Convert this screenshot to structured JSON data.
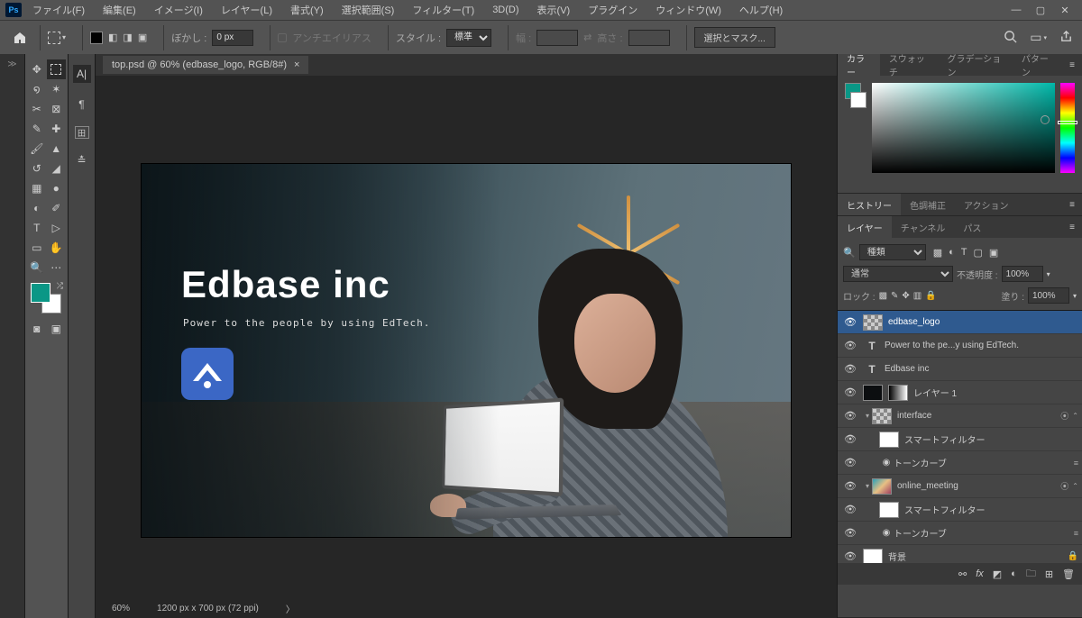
{
  "menubar": {
    "logo": "Ps",
    "items": [
      "ファイル(F)",
      "編集(E)",
      "イメージ(I)",
      "レイヤー(L)",
      "書式(Y)",
      "選択範囲(S)",
      "フィルター(T)",
      "3D(D)",
      "表示(V)",
      "プラグイン",
      "ウィンドウ(W)",
      "ヘルプ(H)"
    ]
  },
  "optionsbar": {
    "feather_label": "ぼかし :",
    "feather_value": "0 px",
    "antialias": "アンチエイリアス",
    "style_label": "スタイル :",
    "style_value": "標準",
    "width_label": "幅 :",
    "height_label": "高さ :",
    "mask_button": "選択とマスク..."
  },
  "document": {
    "tab_title": "top.psd @ 60% (edbase_logo, RGB/8#)",
    "canvas": {
      "heading": "Edbase inc",
      "subheading": "Power to the people by using EdTech."
    }
  },
  "status": {
    "zoom": "60%",
    "dims": "1200 px x 700 px (72 ppi)"
  },
  "panels": {
    "color_tabs": [
      "カラー",
      "スウォッチ",
      "グラデーション",
      "パターン"
    ],
    "history_tabs": [
      "ヒストリー",
      "色調補正",
      "アクション"
    ],
    "layer_tabs": [
      "レイヤー",
      "チャンネル",
      "パス"
    ],
    "layer_filter_label": "種類",
    "blend_mode": "通常",
    "opacity_label": "不透明度 :",
    "opacity_value": "100%",
    "lock_label": "ロック :",
    "fill_label": "塗り :",
    "fill_value": "100%",
    "layers": [
      {
        "name": "edbase_logo",
        "type": "image",
        "selected": true,
        "thumb": "checker"
      },
      {
        "name": "Power to the pe...y using EdTech.",
        "type": "T"
      },
      {
        "name": "Edbase inc",
        "type": "T"
      },
      {
        "name": "レイヤー 1",
        "type": "image",
        "thumb": "grad",
        "extra_thumb": "dark"
      },
      {
        "name": "interface",
        "type": "group",
        "open": true,
        "fx": true,
        "thumb": "checker"
      },
      {
        "name": "スマートフィルター",
        "type": "subfilter",
        "indent": 1,
        "thumb": "white"
      },
      {
        "name": "トーンカーブ",
        "type": "subitem",
        "indent": 1
      },
      {
        "name": "online_meeting",
        "type": "group",
        "open": true,
        "fx": true,
        "thumb": "photo"
      },
      {
        "name": "スマートフィルター",
        "type": "subfilter",
        "indent": 1,
        "thumb": "white"
      },
      {
        "name": "トーンカーブ",
        "type": "subitem",
        "indent": 1
      },
      {
        "name": "背景",
        "type": "image",
        "locked": true,
        "thumb": "white"
      }
    ]
  }
}
